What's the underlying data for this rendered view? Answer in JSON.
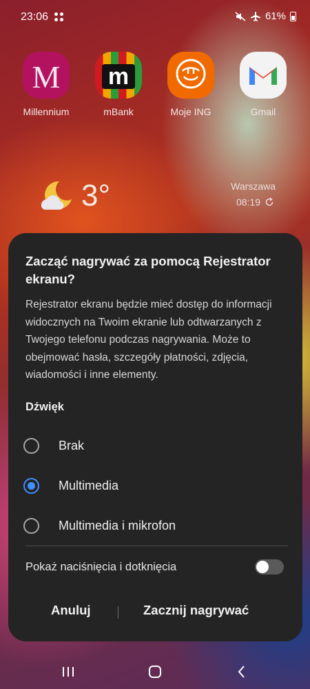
{
  "status_bar": {
    "time": "23:06",
    "battery": "61%"
  },
  "apps": [
    {
      "name": "Millennium",
      "icon": "millennium-icon"
    },
    {
      "name": "mBank",
      "icon": "mbank-icon"
    },
    {
      "name": "Moje ING",
      "icon": "ing-lion-icon"
    },
    {
      "name": "Gmail",
      "icon": "gmail-icon"
    }
  ],
  "weather": {
    "temperature": "3°",
    "city": "Warszawa",
    "updated": "08:19"
  },
  "dialog": {
    "title": "Zacząć nagrywać za pomocą Rejestrator ekranu?",
    "body": "Rejestrator ekranu będzie mieć dostęp do informacji widocznych na Twoim ekranie lub odtwarzanych z Twojego telefonu podczas nagrywania. Może to obejmować hasła, szczegóły płatności, zdjęcia, wiadomości i inne elementy.",
    "sound_section": "Dźwięk",
    "options": [
      {
        "label": "Brak",
        "selected": false
      },
      {
        "label": "Multimedia",
        "selected": true
      },
      {
        "label": "Multimedia i mikrofon",
        "selected": false
      }
    ],
    "show_taps_label": "Pokaż naciśnięcia i dotknięcia",
    "show_taps_enabled": false,
    "cancel_label": "Anuluj",
    "start_label": "Zacznij nagrywać"
  },
  "colors": {
    "accent": "#3e91ff",
    "dialog_bg": "#242424"
  }
}
